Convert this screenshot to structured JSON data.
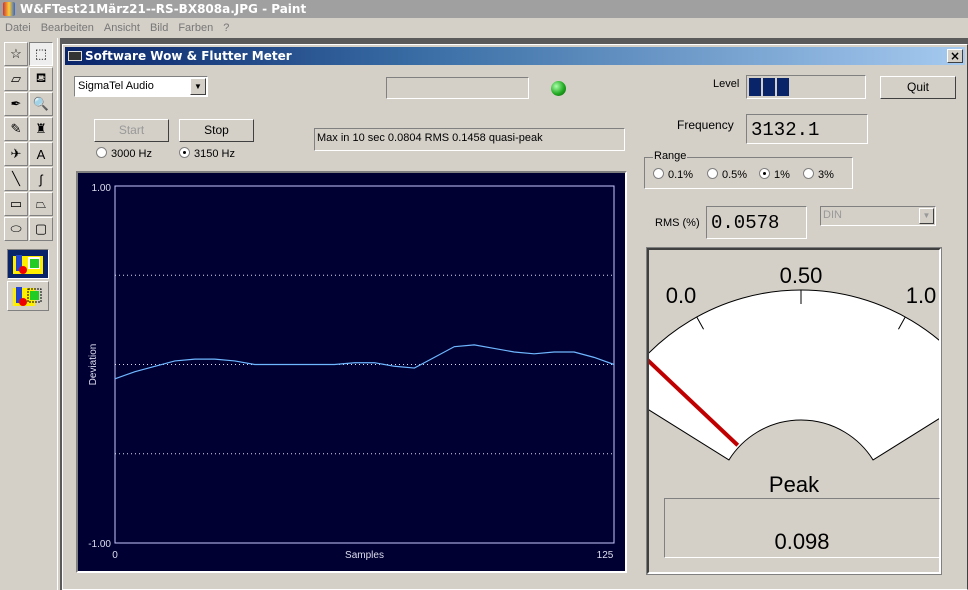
{
  "app": {
    "title": "W&FTest21März21--RS-BX808a.JPG - Paint",
    "menu": [
      "Datei",
      "Bearbeiten",
      "Ansicht",
      "Bild",
      "Farben",
      "?"
    ]
  },
  "toolbox": {
    "tools": [
      {
        "name": "free-form-select-icon",
        "glyph": "☆"
      },
      {
        "name": "rect-select-icon",
        "glyph": "⬚"
      },
      {
        "name": "eraser-icon",
        "glyph": "▱"
      },
      {
        "name": "fill-bucket-icon",
        "glyph": "⛾"
      },
      {
        "name": "color-picker-icon",
        "glyph": "✒"
      },
      {
        "name": "magnifier-icon",
        "glyph": "🔍"
      },
      {
        "name": "pencil-icon",
        "glyph": "✎"
      },
      {
        "name": "brush-icon",
        "glyph": "♜"
      },
      {
        "name": "airbrush-icon",
        "glyph": "✈"
      },
      {
        "name": "text-icon",
        "glyph": "A"
      },
      {
        "name": "line-icon",
        "glyph": "╲"
      },
      {
        "name": "curve-icon",
        "glyph": "ʃ"
      },
      {
        "name": "rectangle-icon",
        "glyph": "▭"
      },
      {
        "name": "polygon-icon",
        "glyph": "⏢"
      },
      {
        "name": "ellipse-icon",
        "glyph": "⬭"
      },
      {
        "name": "rounded-rect-icon",
        "glyph": "▢"
      }
    ]
  },
  "window": {
    "title": "Software Wow & Flutter Meter",
    "close_label": "×",
    "device_select": "SigmaTel Audio",
    "status_box": "",
    "indicator_color": "#22aa22",
    "start_label": "Start",
    "stop_label": "Stop",
    "freq_options": [
      {
        "label": "3000 Hz",
        "selected": false
      },
      {
        "label": "3150 Hz",
        "selected": true
      }
    ],
    "max_text": "Max in 10 sec 0.0804 RMS 0.1458 quasi-peak",
    "level_label": "Level",
    "level_segments_lit": 3,
    "quit_label": "Quit",
    "frequency_label": "Frequency",
    "frequency_value": "3132.1",
    "range_label": "Range",
    "range_options": [
      {
        "label": "0.1%",
        "selected": false
      },
      {
        "label": "0.5%",
        "selected": false
      },
      {
        "label": "1%",
        "selected": true
      },
      {
        "label": "3%",
        "selected": false
      }
    ],
    "rms_label": "RMS (%)",
    "rms_value": "0.0578",
    "weighting_select": "DIN",
    "gauge": {
      "min_label": "0.0",
      "mid_label": "0.50",
      "max_label": "1.0",
      "needle_value": 0.098,
      "peak_label": "Peak",
      "peak_value": "0.098"
    }
  },
  "chart_data": {
    "type": "line",
    "title": "",
    "xlabel": "Samples",
    "ylabel": "Deviation",
    "xlim": [
      0,
      125
    ],
    "ylim": [
      -1.0,
      1.0
    ],
    "x_tick_labels": [
      "0",
      "125"
    ],
    "y_tick_labels": [
      "1.00",
      "-1.00"
    ],
    "gridlines_y": [
      0.5,
      0.0,
      -0.5
    ],
    "series": [
      {
        "name": "deviation",
        "color": "#6fb7ff",
        "x": [
          0,
          5,
          10,
          15,
          20,
          25,
          30,
          35,
          40,
          45,
          50,
          55,
          60,
          65,
          70,
          75,
          80,
          85,
          90,
          95,
          100,
          105,
          110,
          115,
          120,
          125
        ],
        "y": [
          -0.08,
          -0.04,
          -0.01,
          0.02,
          0.03,
          0.03,
          0.02,
          0.0,
          0.0,
          0.0,
          0.0,
          0.0,
          0.01,
          0.01,
          -0.01,
          -0.02,
          0.04,
          0.1,
          0.11,
          0.09,
          0.07,
          0.06,
          0.07,
          0.07,
          0.04,
          0.0
        ]
      }
    ]
  }
}
